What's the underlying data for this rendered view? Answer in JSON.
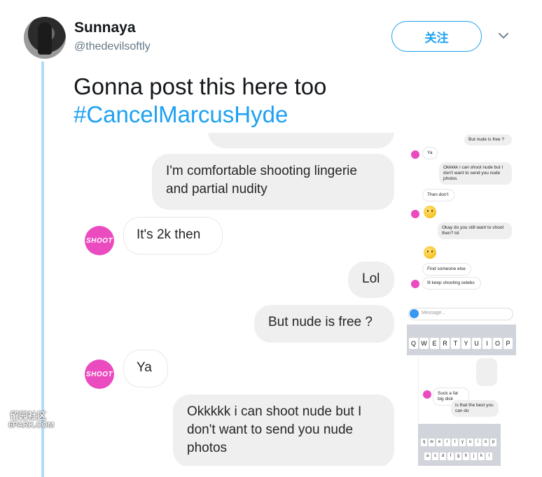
{
  "user": {
    "name": "Sunnaya",
    "handle": "@thedevilsoftly"
  },
  "follow_label": "关注",
  "tweet": {
    "text": "Gonna post this here too",
    "hashtag": "#CancelMarcusHyde"
  },
  "chat_main": {
    "m1": "I'm comfortable shooting lingerie and partial nudity",
    "m2": "It's 2k then",
    "m3": "Lol",
    "m4": "But nude is free ?",
    "m5": "Ya",
    "m6": "Okkkkk i can shoot nude but I don't want to send you nude photos",
    "avatar_label": "SHOOT"
  },
  "chat_side": {
    "s1": "But nude is free ?",
    "s2": "Ya",
    "s3": "Okkkkk i can shoot nude but I don't want to send you nude photos",
    "s4": "Then don't",
    "s5": "Okay do you still want to shoot then? lol",
    "s6": "Find someone else",
    "s7": "Ill keep shooting celebs",
    "composer_placeholder": "Message...",
    "keys": [
      "Q",
      "W",
      "E",
      "R",
      "T",
      "Y",
      "U",
      "I",
      "O",
      "P"
    ],
    "s8": "Suck a fat big dick",
    "s9": "is that the best you can do",
    "mini_keys": [
      "q",
      "w",
      "e",
      "r",
      "t",
      "y",
      "u",
      "i",
      "o",
      "p"
    ],
    "mini_keys2": [
      "a",
      "s",
      "d",
      "f",
      "g",
      "h",
      "j",
      "k",
      "l"
    ]
  },
  "watermark": {
    "line1": "留园社区",
    "line2": "6PARK.COM"
  },
  "colors": {
    "accent": "#1da1f2",
    "thread": "#b1ddf8",
    "shoot": "#ea4cc0"
  }
}
